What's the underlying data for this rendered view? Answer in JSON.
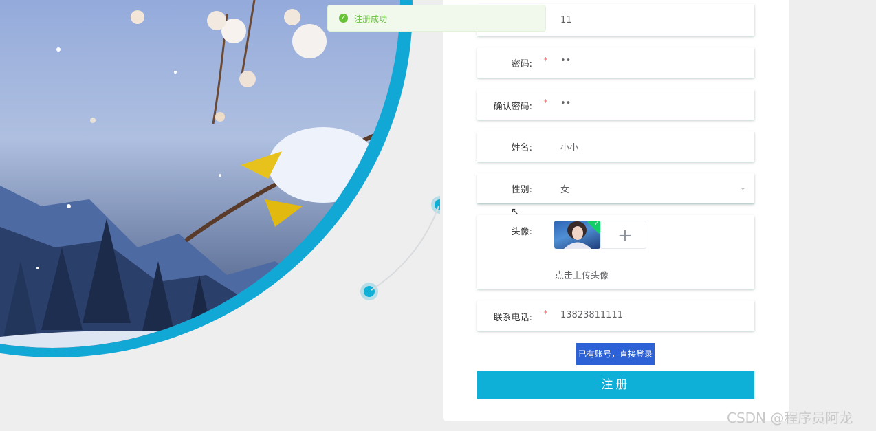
{
  "toast": {
    "icon": "check-circle-icon",
    "message": "注册成功",
    "color": "#67c23a"
  },
  "form": {
    "username_value": "11",
    "password": {
      "label": "密码:",
      "required": "*",
      "value": "••"
    },
    "confirm_password": {
      "label": "确认密码:",
      "required": "*",
      "value": "••"
    },
    "name": {
      "label": "姓名:",
      "value": "小小"
    },
    "gender": {
      "label": "性别:",
      "value": "女",
      "icon": "chevron-down-icon"
    },
    "avatar": {
      "label": "头像:",
      "hint": "点击上传头像",
      "add_icon": "plus-icon",
      "uploaded_badge": "check-icon"
    },
    "phone": {
      "label": "联系电话:",
      "required": "*",
      "value": "13823811111"
    },
    "login_link": "已有账号，直接登录",
    "submit_label": "注册"
  },
  "watermark": "CSDN @程序员阿龙",
  "colors": {
    "accent": "#0fb0d8",
    "link_bg": "#2c62d6",
    "required": "#f56c6c"
  }
}
